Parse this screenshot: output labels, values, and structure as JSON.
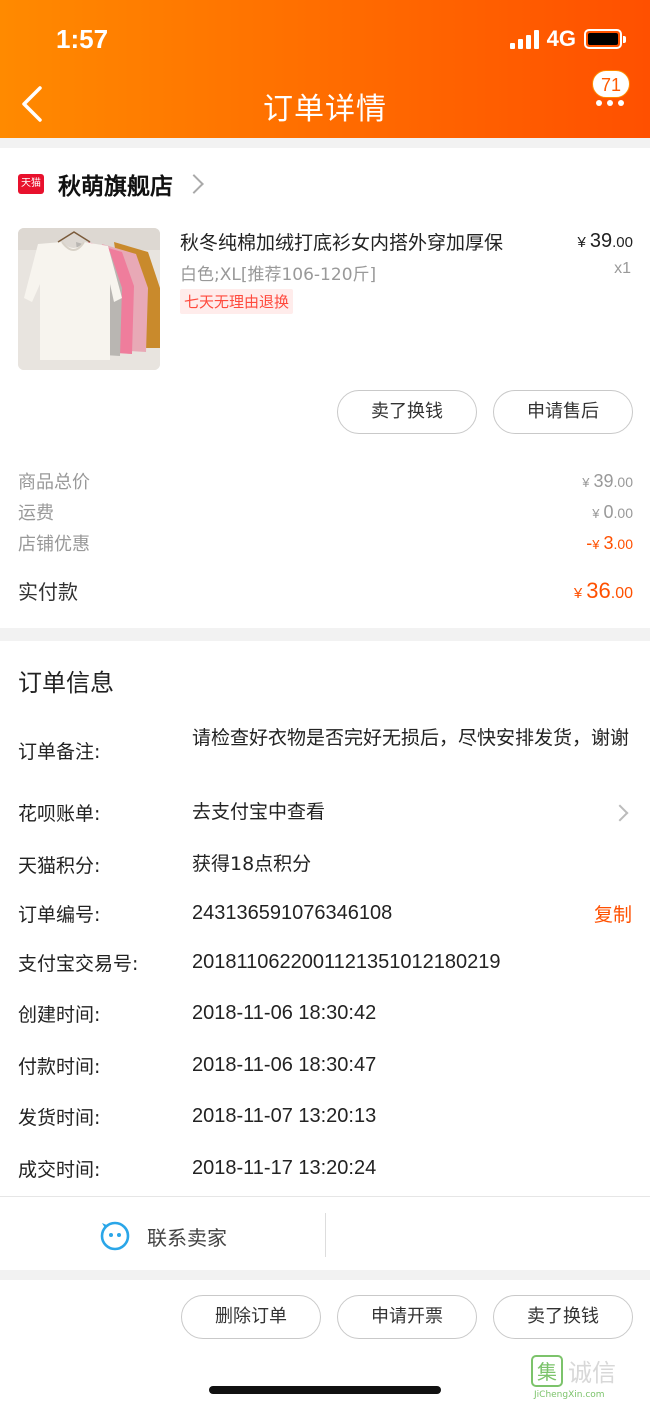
{
  "status_bar": {
    "time": "1:57",
    "network": "4G"
  },
  "header": {
    "title": "订单详情",
    "badge_count": "71"
  },
  "shop": {
    "badge_text": "天猫",
    "name": "秋萌旗舰店",
    "product": {
      "name": "秋冬纯棉加绒打底衫女内搭外穿加厚保",
      "sku": "白色;XL[推荐106-120斤]",
      "tag": "七天无理由退换",
      "price_symbol": "¥",
      "price_int": "39",
      "price_dec": ".00",
      "qty": "x1"
    },
    "actions": {
      "sell_label": "卖了换钱",
      "after_sale_label": "申请售后"
    },
    "summary": {
      "subtotal_label": "商品总价",
      "subtotal_int": "39",
      "subtotal_dec": ".00",
      "shipping_label": "运费",
      "shipping_int": "0",
      "shipping_dec": ".00",
      "discount_label": "店铺优惠",
      "discount_prefix": "-",
      "discount_int": "3",
      "discount_dec": ".00",
      "paid_label": "实付款",
      "paid_int": "36",
      "paid_dec": ".00",
      "currency": "¥"
    }
  },
  "order_info": {
    "title": "订单信息",
    "rows": [
      {
        "label": "订单备注:",
        "value": "请检查好衣物是否完好无损后，尽快安排发货，谢谢"
      },
      {
        "label": "花呗账单:",
        "value": "去支付宝中查看"
      },
      {
        "label": "天猫积分:",
        "value": "获得18点积分"
      },
      {
        "label": "订单编号:",
        "value": "243136591076346108",
        "action": "复制"
      },
      {
        "label": "支付宝交易号:",
        "value": "2018110622001121351012180219"
      },
      {
        "label": "创建时间:",
        "value": "2018-11-06 18:30:42"
      },
      {
        "label": "付款时间:",
        "value": "2018-11-06 18:30:47"
      },
      {
        "label": "发货时间:",
        "value": "2018-11-07 13:20:13"
      },
      {
        "label": "成交时间:",
        "value": "2018-11-17 13:20:24"
      }
    ],
    "contact_label": "联系卖家"
  },
  "bottom_actions": {
    "delete_label": "删除订单",
    "invoice_label": "申请开票",
    "sell_label": "卖了换钱"
  },
  "watermark": {
    "text": "集诚信",
    "sub": "JiChengXin.com"
  },
  "colors": {
    "accent": "#ff5000",
    "header_start": "#ff8a00",
    "tmall_red": "#e8112d"
  }
}
